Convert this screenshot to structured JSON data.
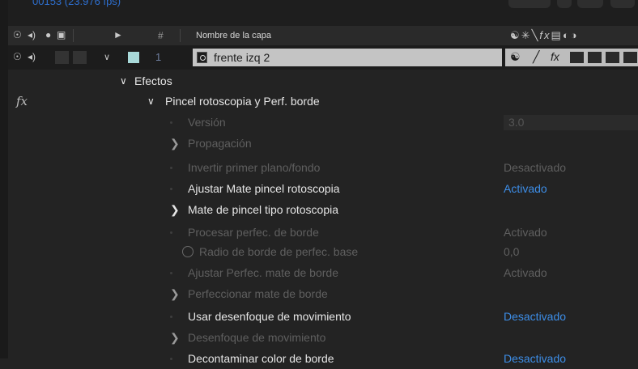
{
  "timeline": {
    "timecode": "00153 (23.976 fps)",
    "header": {
      "number_col": "#",
      "name_col": "Nombre de la capa"
    },
    "layer": {
      "number": "1",
      "name": "frente izq 2",
      "color": "#a8d9d9"
    },
    "effects_group": "Efectos",
    "fx_label": "fx",
    "effect_name": "Pincel rotoscopia y Perf. borde",
    "properties": [
      {
        "label": "Versión",
        "value": "3.0",
        "style": "dim",
        "twirl": false
      },
      {
        "label": "Propagación",
        "value": "",
        "style": "dim",
        "twirl": true
      },
      {
        "label": "Invertir primer plano/fondo",
        "value": "Desactivado",
        "style": "dim",
        "twirl": false
      },
      {
        "label": "Ajustar Mate pincel rotoscopia",
        "value": "Activado",
        "style": "bright",
        "twirl": false
      },
      {
        "label": "Mate de pincel tipo rotoscopia",
        "value": "",
        "style": "bright",
        "twirl": true
      },
      {
        "label": "Procesar perfec. de borde",
        "value": "Activado",
        "style": "dim",
        "twirl": false
      },
      {
        "label": "Radio de borde de perfec. base",
        "value": "0,0",
        "style": "dim",
        "twirl": false
      },
      {
        "label": "Ajustar Perfec. mate de borde",
        "value": "Activado",
        "style": "dim",
        "twirl": false
      },
      {
        "label": "Perfeccionar mate de borde",
        "value": "",
        "style": "dim",
        "twirl": true
      },
      {
        "label": "Usar desenfoque de movimiento",
        "value": "Desactivado",
        "style": "bright",
        "twirl": false
      },
      {
        "label": "Desenfoque de movimiento",
        "value": "",
        "style": "dim",
        "twirl": true
      },
      {
        "label": "Decontaminar color de borde",
        "value": "Desactivado",
        "style": "bright",
        "twirl": false
      }
    ]
  }
}
